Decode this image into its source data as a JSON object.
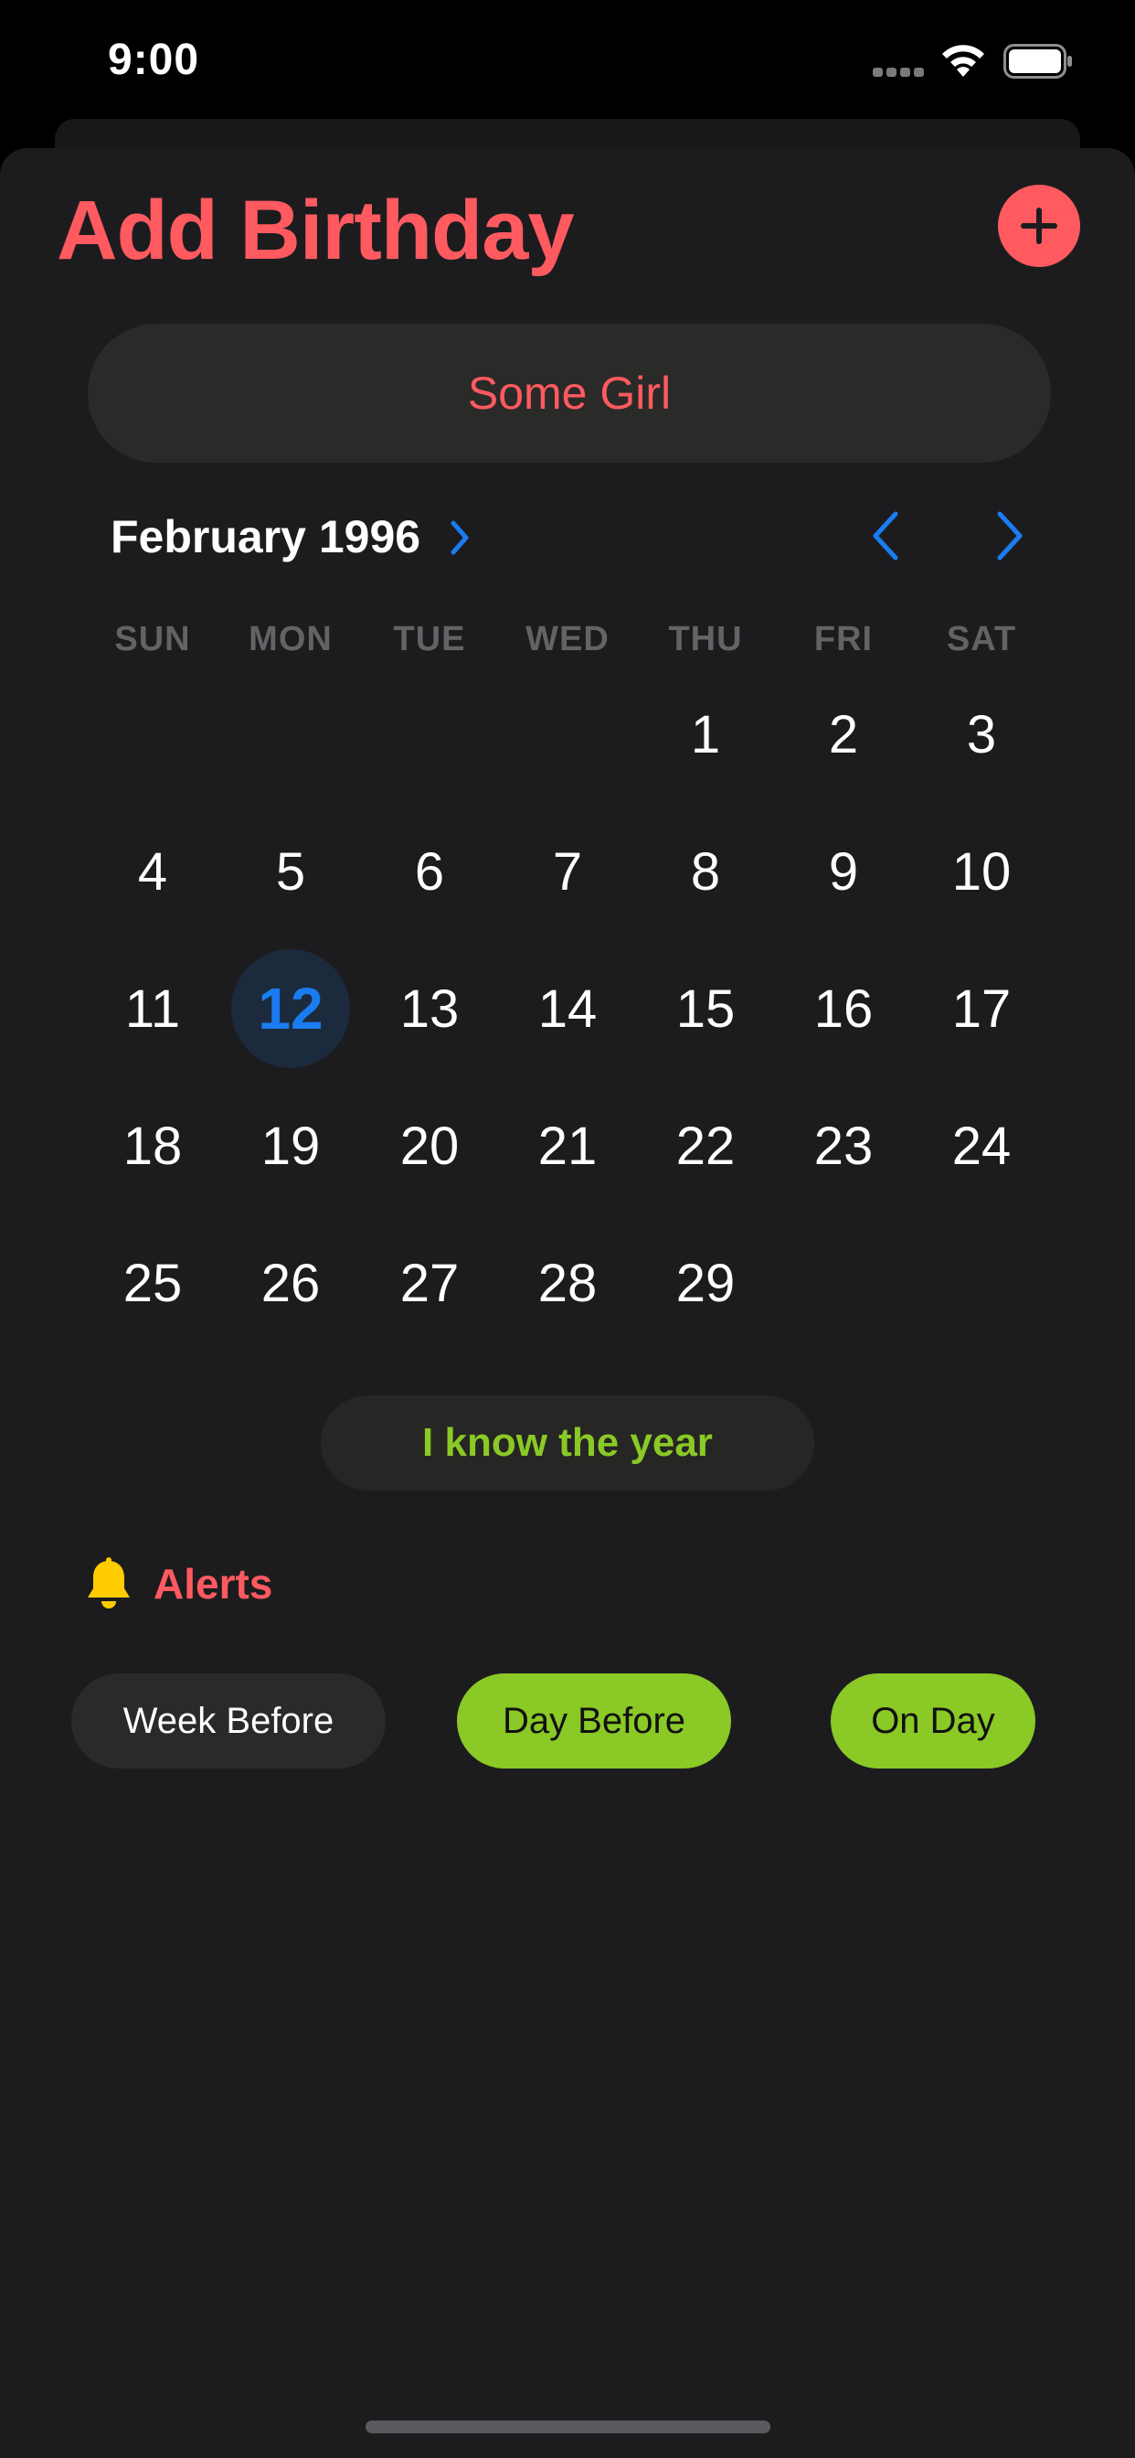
{
  "status_bar": {
    "time": "9:00",
    "icons": [
      "cellular-signal-icon",
      "wifi-icon",
      "battery-icon"
    ]
  },
  "header": {
    "title": "Add Birthday",
    "add_icon": "plus-icon"
  },
  "name_field": {
    "value": "Some Girl"
  },
  "calendar": {
    "month_label": "February 1996",
    "expand_icon": "chevron-right-icon",
    "prev_icon": "chevron-left-icon",
    "next_icon": "chevron-right-icon",
    "weekdays": [
      "SUN",
      "MON",
      "TUE",
      "WED",
      "THU",
      "FRI",
      "SAT"
    ],
    "first_weekday_index": 4,
    "days": [
      "1",
      "2",
      "3",
      "4",
      "5",
      "6",
      "7",
      "8",
      "9",
      "10",
      "11",
      "12",
      "13",
      "14",
      "15",
      "16",
      "17",
      "18",
      "19",
      "20",
      "21",
      "22",
      "23",
      "24",
      "25",
      "26",
      "27",
      "28",
      "29"
    ],
    "selected_day": "12"
  },
  "year_toggle": {
    "label": "I know the year"
  },
  "alerts": {
    "icon": "bell-icon",
    "label": "Alerts",
    "options": [
      {
        "label": "Week Before",
        "selected": false
      },
      {
        "label": "Day Before",
        "selected": true
      },
      {
        "label": "On Day",
        "selected": true
      }
    ]
  },
  "colors": {
    "accent_red": "#ff5a60",
    "accent_green": "#8ac926",
    "accent_blue": "#1a7cf0",
    "background": "#1c1c1e",
    "bell_yellow": "#ffcc00"
  }
}
